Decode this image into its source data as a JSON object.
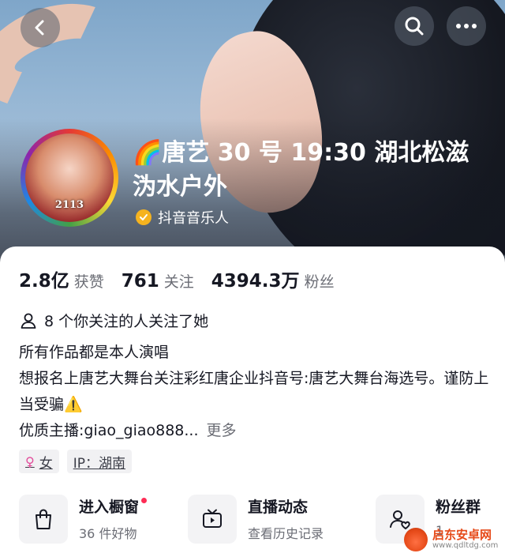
{
  "header": {
    "back_icon": "chevron-left-icon",
    "search_icon": "search-icon",
    "more_icon": "more-horizontal-icon"
  },
  "profile": {
    "avatar_number": "2113",
    "name": "🌈唐艺 30 号 19:30 湖北松滋沩水户外",
    "badge_icon": "verified-check-icon",
    "badge_label": "抖音音乐人"
  },
  "stats": [
    {
      "value": "2.8亿",
      "label": "获赞"
    },
    {
      "value": "761",
      "label": "关注"
    },
    {
      "value": "4394.3万",
      "label": "粉丝"
    }
  ],
  "mutual": {
    "icon": "person-icon",
    "text": "8 个你关注的人关注了她"
  },
  "bio": {
    "line1": "所有作品都是本人演唱",
    "line2": "想报名上唐艺大舞台关注彩红唐企业抖音号:唐艺大舞台海选号。谨防上当受骗⚠️",
    "line3": "优质主播:giao_giao888...",
    "more": "更多"
  },
  "tags": {
    "gender_symbol": "♀",
    "gender": "女",
    "ip": "IP：湖南"
  },
  "shortcuts": [
    {
      "icon": "shopping-bag-icon",
      "title": "进入橱窗",
      "subtitle": "36 件好物"
    },
    {
      "icon": "tv-icon",
      "title": "直播动态",
      "subtitle": "查看历史记录"
    },
    {
      "icon": "fan-group-icon",
      "title": "粉丝群",
      "subtitle": "1"
    }
  ],
  "watermark": {
    "title": "启东安卓网",
    "url": "www.qdltdg.com"
  },
  "colors": {
    "accent_red": "#fe2c55",
    "verified_gold": "#f5b31f",
    "text_primary": "#161823",
    "text_secondary": "#6b6d75"
  }
}
